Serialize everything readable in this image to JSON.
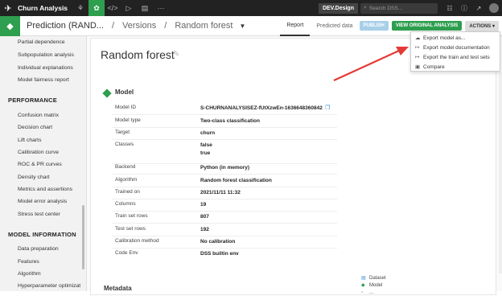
{
  "topbar": {
    "project_name": "Churn Analysis",
    "instance_badge": "DEV.Design",
    "search_placeholder": "Search DSS...",
    "icons": [
      "share-icon",
      "flow-icon",
      "code-icon",
      "play-icon",
      "notebook-icon",
      "more-icon",
      "grid-icon",
      "help-icon",
      "trend-icon",
      "user-avatar"
    ]
  },
  "header": {
    "crumb_model": "Prediction (RAND...",
    "crumb_sep_1": "/",
    "crumb_versions": "Versions",
    "crumb_sep_2": "/",
    "crumb_current": "Random forest",
    "tabs": [
      {
        "label": "Report",
        "active": true
      },
      {
        "label": "Predicted data",
        "active": false
      }
    ],
    "publish_label": "PUBLISH",
    "view_original_label": "VIEW ORIGINAL ANALYSIS",
    "actions_label": "ACTIONS"
  },
  "sidebar": {
    "items_top": [
      "Partial dependence",
      "Subpopulation analysis",
      "Individual explanations",
      "Model fairness report"
    ],
    "section_performance": "PERFORMANCE",
    "performance_items": [
      "Confusion matrix",
      "Decision chart",
      "Lift charts",
      "Calibration curve",
      "ROC & PR curves",
      "Density chart",
      "Metrics and assertions",
      "Model error analysis",
      "Stress test center"
    ],
    "section_model_info": "MODEL INFORMATION",
    "model_info_items": [
      "Data preparation",
      "Features",
      "Algorithm",
      "Hyperparameter optimizat"
    ]
  },
  "main": {
    "title": "Random forest",
    "section_title": "Model",
    "rows": [
      {
        "label": "Model ID",
        "value": "S-CHURNANALYSISEZ-fUtXzwEn-1636648360842"
      },
      {
        "label": "Model type",
        "value": "Two-class classification"
      },
      {
        "label": "Target",
        "value": "churn"
      },
      {
        "label": "Classes",
        "value": "false",
        "value2": "true"
      },
      {
        "label": "Backend",
        "value": "Python (in memory)"
      },
      {
        "label": "Algorithm",
        "value": "Random forest classification"
      },
      {
        "label": "Trained on",
        "value": "2021/11/11 11:32"
      },
      {
        "label": "Columns",
        "value": "19"
      },
      {
        "label": "Train set rows",
        "value": "807"
      },
      {
        "label": "Test set rows",
        "value": "192"
      },
      {
        "label": "Calibration method",
        "value": "No calibration"
      },
      {
        "label": "Code Env",
        "value": "DSS builtin env"
      }
    ],
    "metadata_title": "Metadata",
    "toc": [
      "Dataset",
      "Model",
      "..."
    ]
  },
  "actions_menu": {
    "items": [
      {
        "label": "Export model as...",
        "icon": "cloud-download-icon"
      },
      {
        "label": "Export model documentation",
        "icon": "export-icon"
      },
      {
        "label": "Export the train and test sets",
        "icon": "export-icon"
      },
      {
        "label": "Compare",
        "icon": "compare-icon"
      }
    ]
  },
  "annotation": {
    "color": "#e53935"
  },
  "colors": {
    "accent_green": "#2e9e4f",
    "topbar": "#222222",
    "publish": "#a8cfe8"
  }
}
